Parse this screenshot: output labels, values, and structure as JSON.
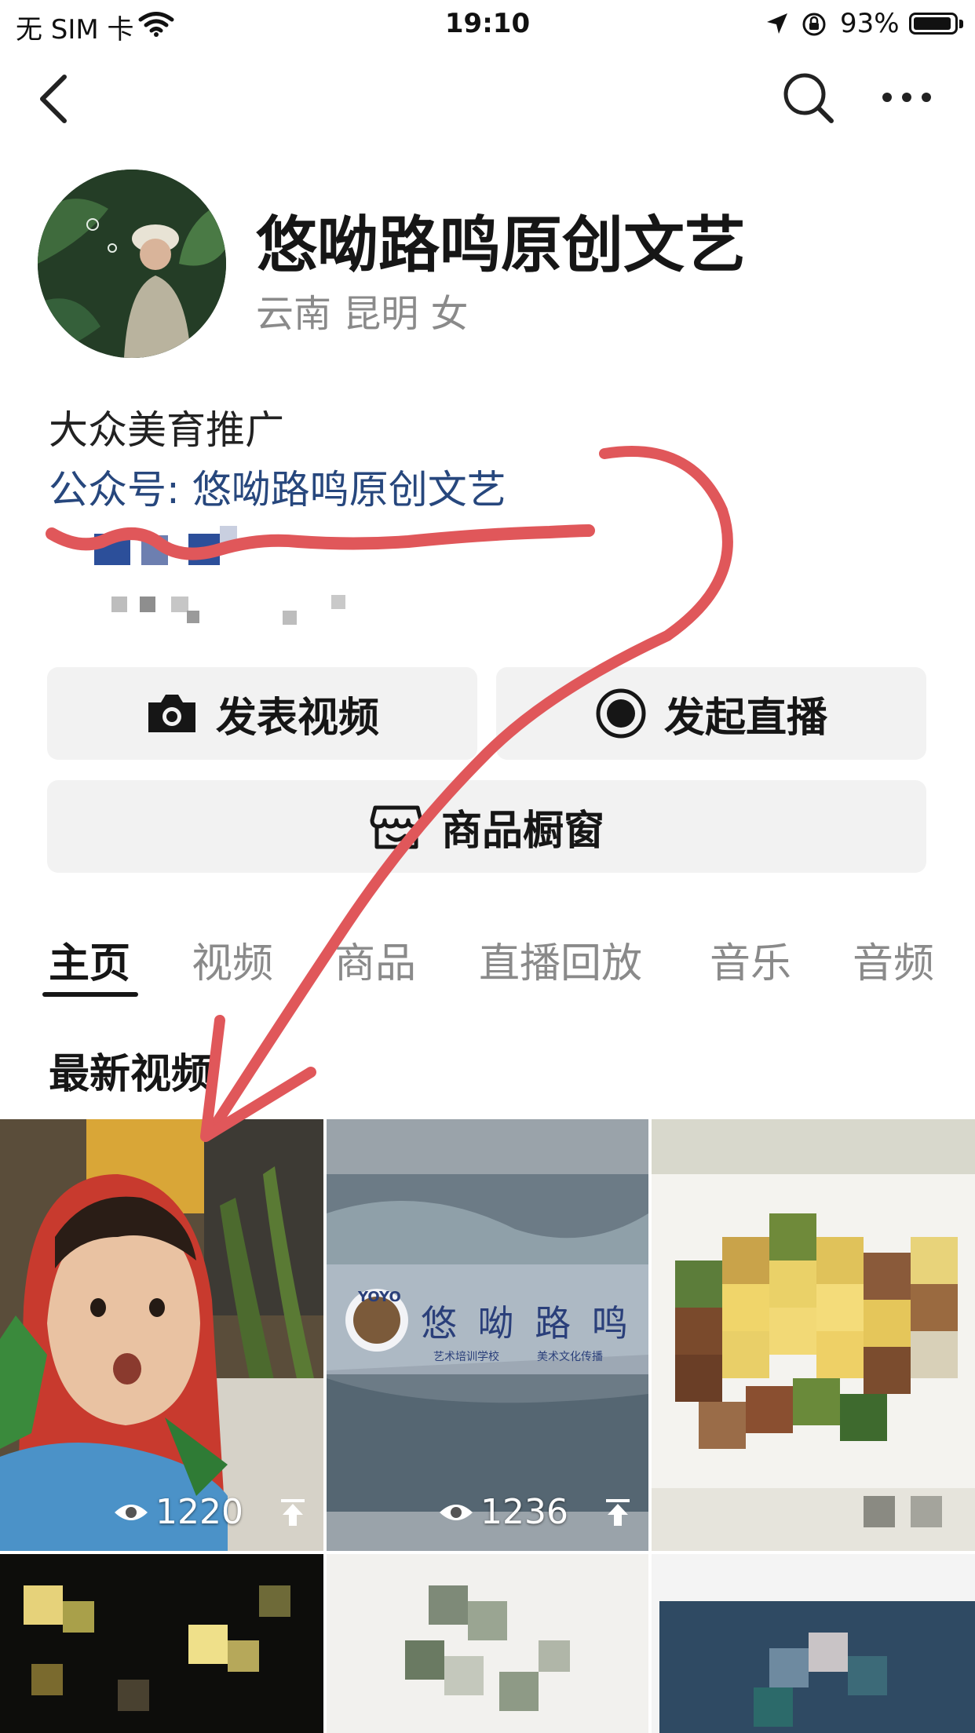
{
  "status_bar": {
    "carrier": "无 SIM 卡",
    "time": "19:10",
    "battery": "93%"
  },
  "profile": {
    "name": "悠呦路鸣原创文艺",
    "location": "云南 昆明 女",
    "bio_line1": "大众美育推广",
    "bio_line2": "公众号: 悠呦路鸣原创文艺"
  },
  "actions": {
    "publish_video": "发表视频",
    "start_live": "发起直播",
    "shop_window": "商品橱窗"
  },
  "tabs": [
    "主页",
    "视频",
    "商品",
    "直播回放",
    "音乐",
    "音频"
  ],
  "section_title": "最新视频",
  "videos": [
    {
      "views": "1220"
    },
    {
      "views": "1236",
      "logo_title": "悠 呦 路 鸣",
      "logo_sub_left": "艺术培训学校",
      "logo_sub_right": "美术文化传播",
      "logo_mark": "YOYO"
    },
    {}
  ],
  "icons": {
    "back": "chevron-left-icon",
    "search": "search-icon",
    "more": "more-icon",
    "camera": "camera-icon",
    "live": "live-record-icon",
    "shop": "shop-icon",
    "eye": "eye-icon",
    "pin": "pin-top-icon"
  },
  "colors": {
    "link": "#27477d",
    "button_bg": "#f2f2f2",
    "annotation": "#e0575a"
  }
}
